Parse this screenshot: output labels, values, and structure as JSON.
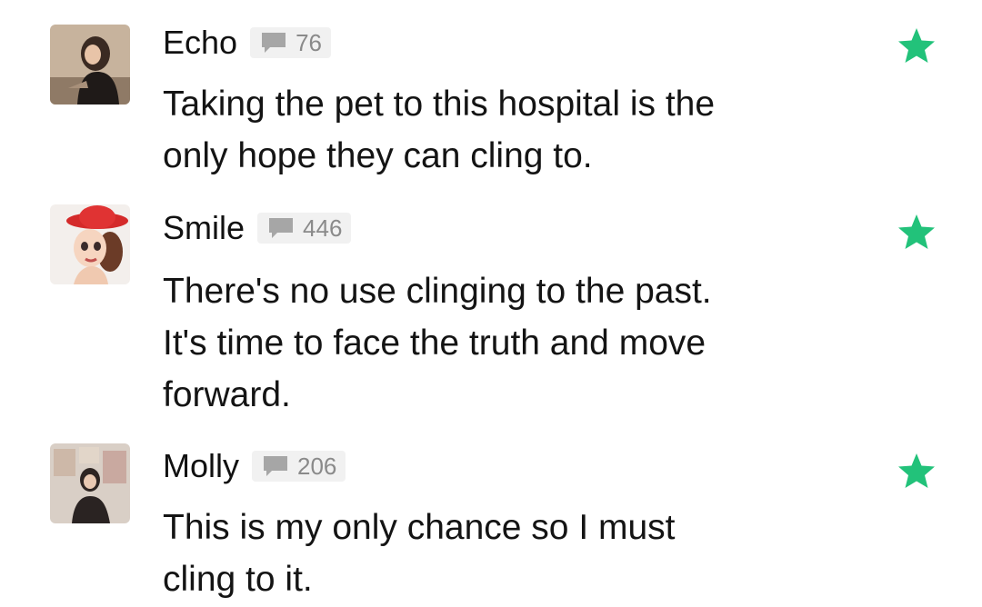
{
  "colors": {
    "star": "#22c27a",
    "badge_bg": "#f1f1f1",
    "count_text": "#8a8a8a",
    "text": "#141414"
  },
  "comments": [
    {
      "username": "Echo",
      "count": "76",
      "text_lines": [
        "Taking the pet to this hospital is the",
        "only hope they can cling to."
      ],
      "avatar_icon": "avatar-photo",
      "badge_icon": "comment-bubble-icon",
      "action_icon": "star-icon"
    },
    {
      "username": "Smile",
      "count": "446",
      "text_lines": [
        "There's no use clinging to the past.",
        "It's time to face the truth and move",
        "forward."
      ],
      "avatar_icon": "avatar-cartoon",
      "badge_icon": "comment-bubble-icon",
      "action_icon": "star-icon"
    },
    {
      "username": "Molly",
      "count": "206",
      "text_lines": [
        "This is my only chance so I must",
        "cling to it."
      ],
      "avatar_icon": "avatar-photo",
      "badge_icon": "comment-bubble-icon",
      "action_icon": "star-icon"
    }
  ]
}
